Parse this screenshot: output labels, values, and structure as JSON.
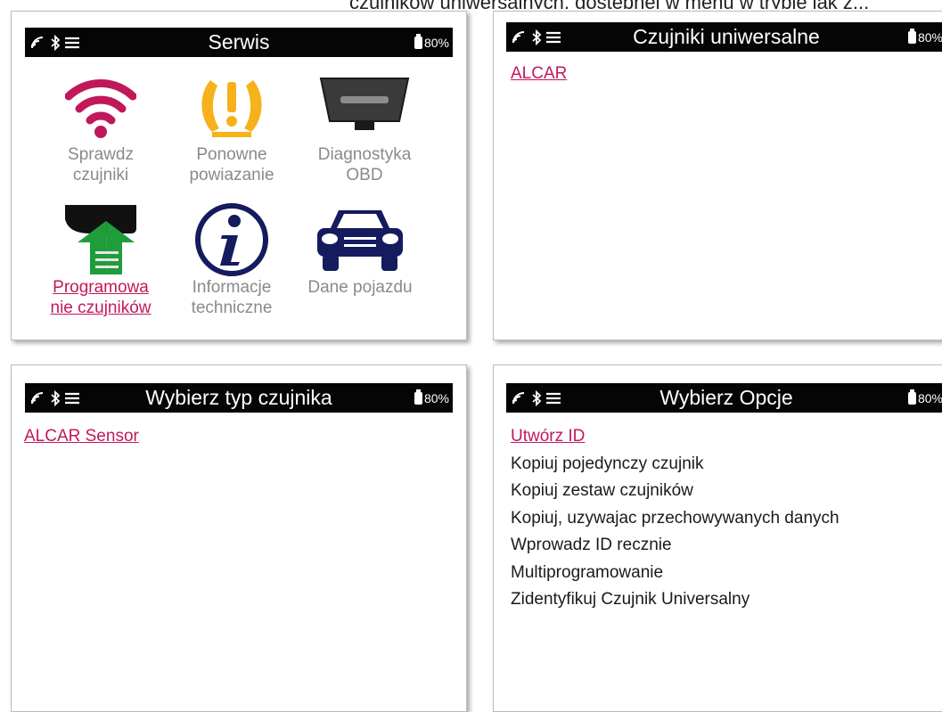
{
  "colors": {
    "accent": "#c2185b",
    "statusbar": "#050505",
    "wifi": "#c0185a",
    "warning": "#f6b21b",
    "dark": "#333333",
    "navy": "#141b5e",
    "green": "#1f9d3a"
  },
  "top_cut_text": "czujników uniwersalnych, dostępnej w menu w trybie jak z...",
  "status": {
    "battery": "80%",
    "icons": [
      "signal-icon",
      "bluetooth-icon",
      "menu-icon",
      "battery-icon"
    ]
  },
  "service_screen": {
    "title": "Serwis",
    "items": [
      {
        "line1": "Sprawdz",
        "line2": "czujniki",
        "icon": "wifi-icon"
      },
      {
        "line1": "Ponowne",
        "line2": "powiazanie",
        "icon": "tpms-warning-icon"
      },
      {
        "line1": "Diagnostyka",
        "line2": "OBD",
        "icon": "obd-connector-icon"
      },
      {
        "line1": "Programowa",
        "line2": "nie czujników",
        "icon": "sensor-program-icon"
      },
      {
        "line1": "Informacje",
        "line2": "techniczne",
        "icon": "info-icon"
      },
      {
        "line1": "Dane pojazdu",
        "line2": "",
        "icon": "car-icon"
      }
    ]
  },
  "universal_screen": {
    "title": "Czujniki uniwersalne",
    "items": [
      "ALCAR"
    ]
  },
  "sensor_type_screen": {
    "title": "Wybierz typ czujnika",
    "items": [
      "ALCAR Sensor"
    ]
  },
  "options_screen": {
    "title": "Wybierz Opcje",
    "items": [
      "Utwórz ID ",
      "Kopiuj pojedynczy czujnik",
      "Kopiuj zestaw czujników",
      "Kopiuj, uzywajac przechowywanych danych",
      "Wprowadz ID recznie",
      "Multiprogramowanie",
      "Zidentyfikuj Czujnik Universalny"
    ]
  }
}
